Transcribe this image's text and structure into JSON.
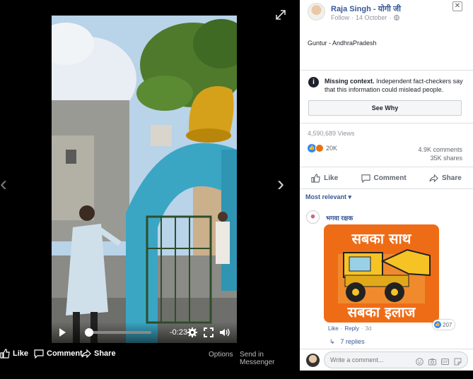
{
  "viewer": {
    "time_remaining": "-0:23",
    "footer": {
      "like_label": "Like",
      "comment_label": "Comment",
      "share_label": "Share",
      "options_label": "Options",
      "send_label": "Send in Messenger"
    },
    "progress_fraction": 0.06
  },
  "post": {
    "author": "Raja Singh - योगी जी",
    "follow_label": "Follow",
    "date": "14 October",
    "text": "Guntur - AndhraPradesh",
    "fact_check": {
      "title": "Missing context.",
      "body": "Independent fact-checkers say that this information could mislead people.",
      "button": "See Why"
    },
    "views": "4,590,689 Views",
    "reaction_count": "20K",
    "comments_count": "4.9K comments",
    "shares_count": "35K shares",
    "actions": {
      "like": "Like",
      "comment": "Comment",
      "share": "Share"
    },
    "sort_label": "Most relevant ▾"
  },
  "comment": {
    "author": "भगवा रक्षक",
    "sticker_line1": "सबका साथ",
    "sticker_line2": "सबका इलाज",
    "reaction_count": "207",
    "like_label": "Like",
    "reply_label": "Reply",
    "age": "3d",
    "replies_label": "7 replies",
    "replies_arrow": "↳"
  },
  "composer": {
    "placeholder": "Write a comment..."
  },
  "colors": {
    "link_blue": "#385898",
    "sticker_orange": "#ef6c17",
    "wall_blue": "#3aa6c4"
  }
}
